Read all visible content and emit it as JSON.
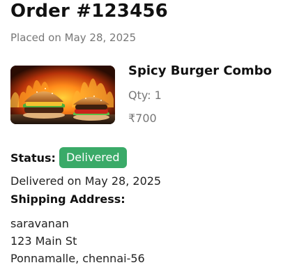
{
  "order": {
    "title": "Order #123456",
    "placed_on": "Placed on May 28, 2025"
  },
  "item": {
    "image_icon": "burger-photo",
    "name": "Spicy Burger Combo",
    "qty": "Qty: 1",
    "price": "₹700"
  },
  "status": {
    "label": "Status:",
    "value": "Delivered",
    "badge_color": "#3aaa68",
    "delivered_on": "Delivered on May 28, 2025"
  },
  "shipping": {
    "label": "Shipping Address:",
    "lines": [
      "saravanan",
      "123 Main St",
      "Ponnamalle, chennai-56"
    ]
  }
}
